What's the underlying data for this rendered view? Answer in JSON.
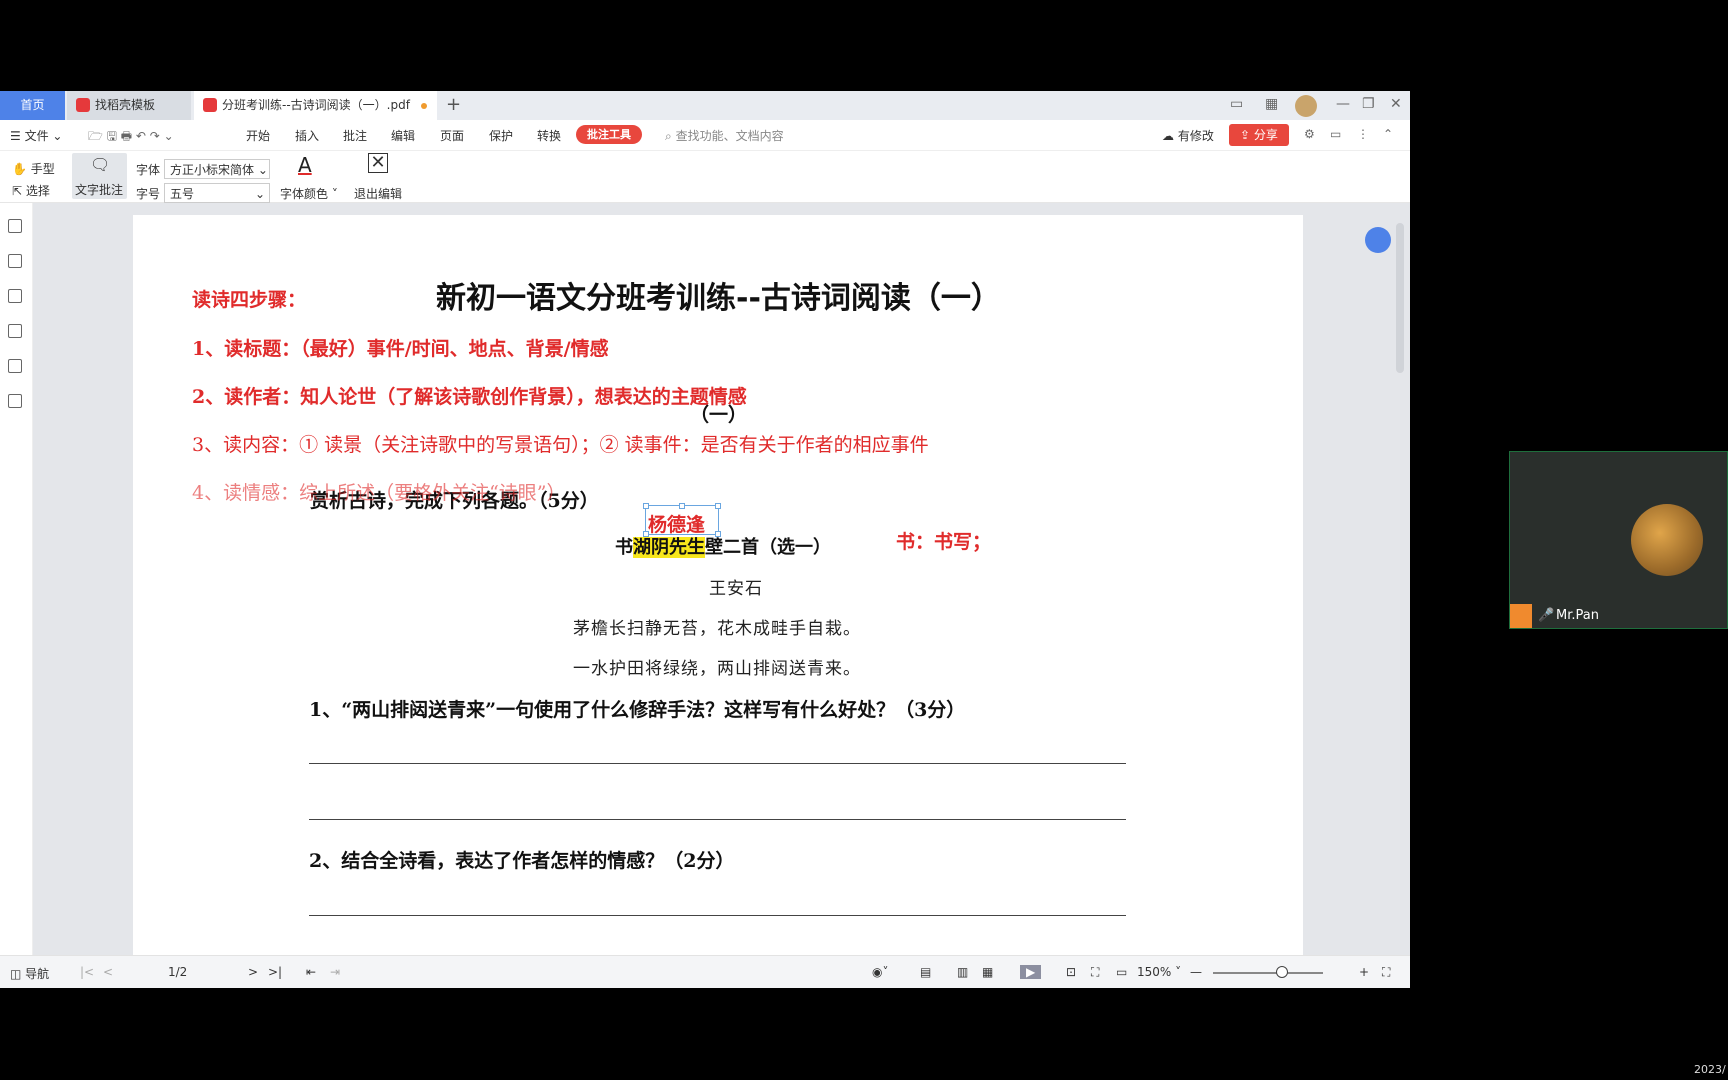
{
  "tabs": {
    "home": "首页",
    "docer": "找稻壳模板",
    "pdf": "分班考训练--古诗词阅读（一）.pdf"
  },
  "menu": {
    "file": "文件",
    "items": [
      "开始",
      "插入",
      "批注",
      "编辑",
      "页面",
      "保护",
      "转换"
    ],
    "tool": "批注工具",
    "search": "查找功能、文档内容",
    "edit": "有修改",
    "share": "分享"
  },
  "ribbon": {
    "hand": "手型",
    "select": "选择",
    "text_note": "文字批注",
    "font_label": "字体",
    "font_value": "方正小标宋简体",
    "size_label": "字号",
    "size_value": "五号",
    "font_color": "字体颜色",
    "exit_edit": "退出编辑"
  },
  "page": {
    "steps_title": "读诗四步骤：",
    "title": "新初一语文分班考训练--古诗词阅读（一）",
    "step1": "1、读标题：（最好）事件/时间、地点、背景/情感",
    "step2": "2、读作者：知人论世（了解该诗歌创作背景），想表达的主题情感",
    "section": "（一）",
    "step3": "3、读内容：① 读景（关注诗歌中的写景语句）；② 读事件：是否有关于作者的相应事件",
    "step4": "4、读情感：综上所述（要格外关注“诗眼”）",
    "instruction": "赏析古诗，完成下列各题。（5分）",
    "annot_name": "杨德逢",
    "poem_title_a": "书",
    "poem_title_hl": "湖阴先生",
    "poem_title_b": "壁二首（选一）",
    "annot_shu": "书：书写；",
    "author": "王安石",
    "line1": "茅檐长扫静无苔，花木成畦手自栽。",
    "line2": "一水护田将绿绕，两山排闼送青来。",
    "q1": "1、“两山排闼送青来”一句使用了什么修辞手法？这样写有什么好处？（3分）",
    "q2": "2、结合全诗看，表达了作者怎样的情感？（2分）"
  },
  "status": {
    "nav": "导航",
    "page": "1/2",
    "zoom": "150%"
  },
  "video": {
    "name": "Mr.Pan"
  },
  "clock": "2023/"
}
